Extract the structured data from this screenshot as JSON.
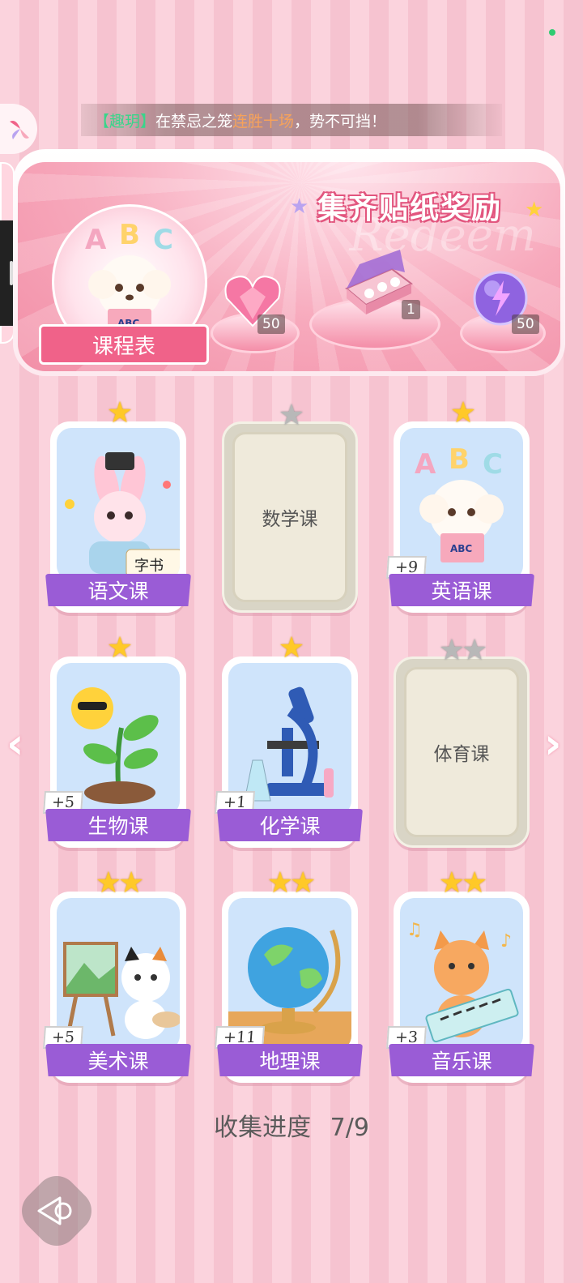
{
  "ticker": {
    "name": "【趣玥】",
    "before": "在禁忌之笼",
    "highlight": "连胜十场",
    "after": "，势不可挡！"
  },
  "banner": {
    "title": "集齐贴纸奖励",
    "watermark": "Redeem",
    "schedule_label": "课程表",
    "rewards": [
      {
        "icon": "pink-heart-gem-icon",
        "count": "50"
      },
      {
        "icon": "gift-box-icon",
        "count": "1"
      },
      {
        "icon": "purple-energy-orb-icon",
        "count": "50"
      }
    ]
  },
  "courses": [
    {
      "name": "语文课",
      "stars": 1,
      "locked": false,
      "bonus": "",
      "art": "bunny-calligraphy"
    },
    {
      "name": "数学课",
      "stars": 1,
      "locked": true,
      "bonus": "",
      "art": ""
    },
    {
      "name": "英语课",
      "stars": 1,
      "locked": false,
      "bonus": "+9",
      "art": "puppy-abc"
    },
    {
      "name": "生物课",
      "stars": 1,
      "locked": false,
      "bonus": "+5",
      "art": "sun-sprout"
    },
    {
      "name": "化学课",
      "stars": 1,
      "locked": false,
      "bonus": "+1",
      "art": "microscope"
    },
    {
      "name": "体育课",
      "stars": 2,
      "locked": true,
      "bonus": "",
      "art": ""
    },
    {
      "name": "美术课",
      "stars": 2,
      "locked": false,
      "bonus": "+5",
      "art": "cat-painter"
    },
    {
      "name": "地理课",
      "stars": 2,
      "locked": false,
      "bonus": "+11",
      "art": "globe"
    },
    {
      "name": "音乐课",
      "stars": 2,
      "locked": false,
      "bonus": "+3",
      "art": "cat-keyboard"
    }
  ],
  "progress": {
    "label": "收集进度",
    "value": "7/9"
  },
  "colors": {
    "accent": "#9a5cd6",
    "ribbon": "#f06289",
    "star": "#ffc928"
  }
}
